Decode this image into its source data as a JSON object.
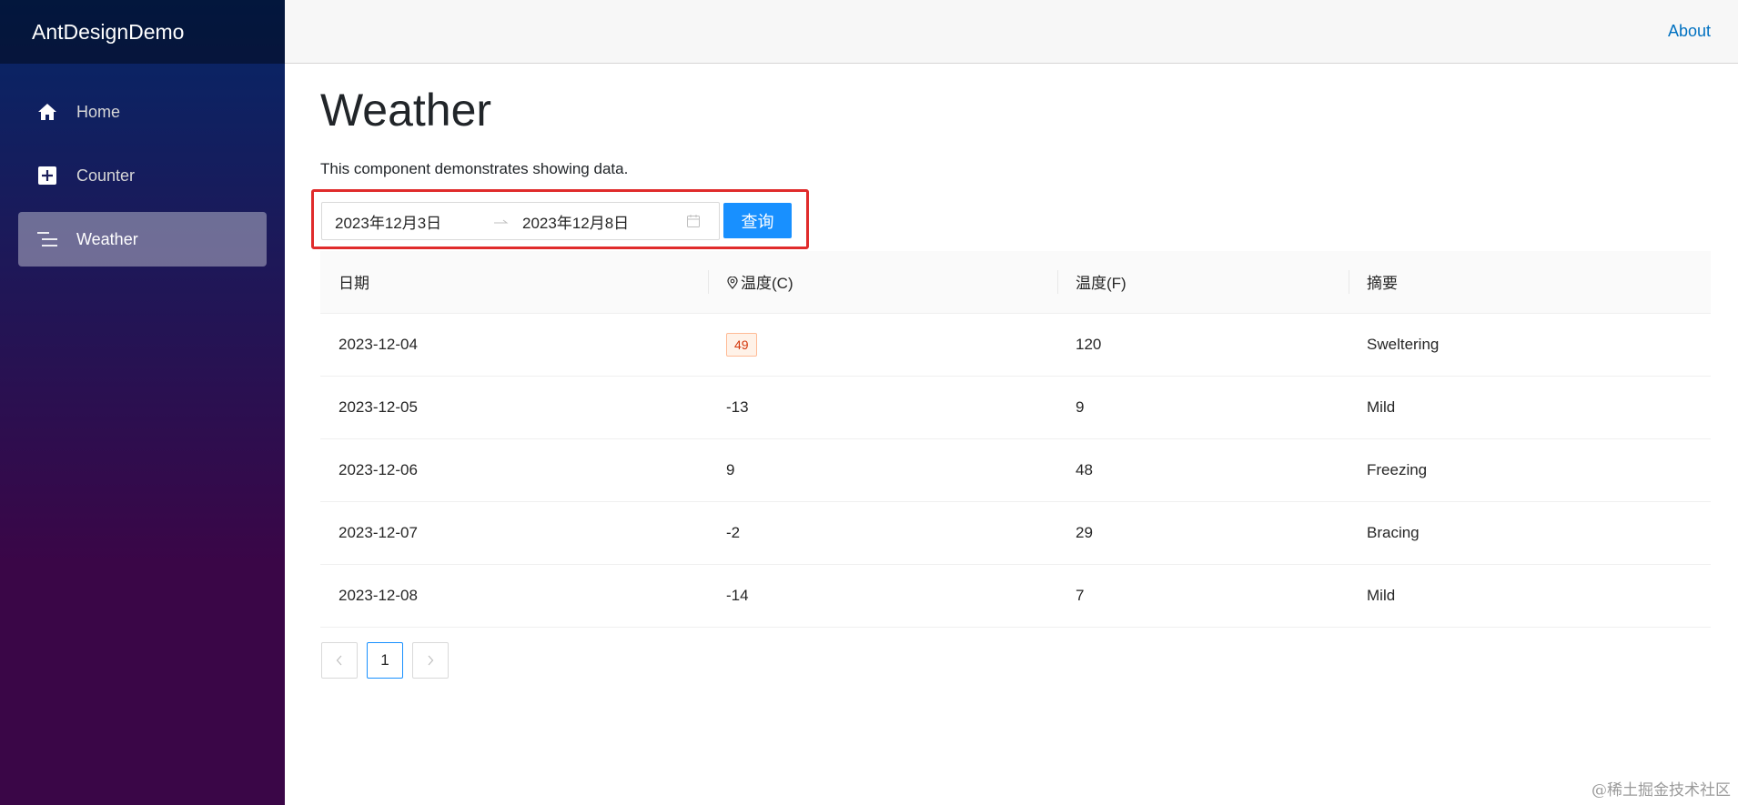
{
  "app": {
    "brand": "AntDesignDemo"
  },
  "topbar": {
    "about_label": "About"
  },
  "sidebar": {
    "items": [
      {
        "label": "Home",
        "icon": "home-icon"
      },
      {
        "label": "Counter",
        "icon": "plus-square-icon"
      },
      {
        "label": "Weather",
        "icon": "list-icon",
        "active": true
      }
    ]
  },
  "page": {
    "title": "Weather",
    "intro": "This component demonstrates showing data."
  },
  "filter": {
    "start_date": "2023年12月3日",
    "end_date": "2023年12月8日",
    "separator": "→",
    "query_label": "查询"
  },
  "table": {
    "columns": [
      "日期",
      "温度(C)",
      "温度(F)",
      "摘要"
    ],
    "rows": [
      {
        "date": "2023-12-04",
        "temp_c": "49",
        "temp_f": "120",
        "summary": "Sweltering",
        "highlight": true
      },
      {
        "date": "2023-12-05",
        "temp_c": "-13",
        "temp_f": "9",
        "summary": "Mild"
      },
      {
        "date": "2023-12-06",
        "temp_c": "9",
        "temp_f": "48",
        "summary": "Freezing"
      },
      {
        "date": "2023-12-07",
        "temp_c": "-2",
        "temp_f": "29",
        "summary": "Bracing"
      },
      {
        "date": "2023-12-08",
        "temp_c": "-14",
        "temp_f": "7",
        "summary": "Mild"
      }
    ]
  },
  "pagination": {
    "prev": "<",
    "current": "1",
    "next": ">"
  },
  "watermark": "@稀土掘金技术社区",
  "colors": {
    "primary": "#1890ff",
    "highlight_box": "#e02b2b",
    "link": "#0071c1"
  }
}
